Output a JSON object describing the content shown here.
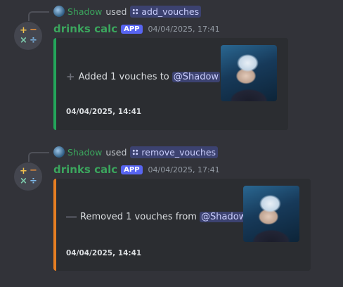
{
  "messages": [
    {
      "reply": {
        "user": "Shadow",
        "used": "used",
        "command": "add_vouches"
      },
      "bot_name": "drinks calc",
      "app_tag": "APP",
      "timestamp": "04/04/2025, 17:41",
      "embed": {
        "accent": "#23a55a",
        "icon": "plus-icon",
        "text": "Added 1 vouches to",
        "mention": "@Shadow",
        "footer": "04/04/2025, 14:41"
      }
    },
    {
      "reply": {
        "user": "Shadow",
        "used": "used",
        "command": "remove_vouches"
      },
      "bot_name": "drinks calc",
      "app_tag": "APP",
      "timestamp": "04/04/2025, 17:41",
      "embed": {
        "accent": "#e67e22",
        "icon": "minus-icon",
        "text": "Removed 1 vouches from",
        "mention": "@Shadow",
        "footer": "04/04/2025, 14:41"
      }
    }
  ]
}
